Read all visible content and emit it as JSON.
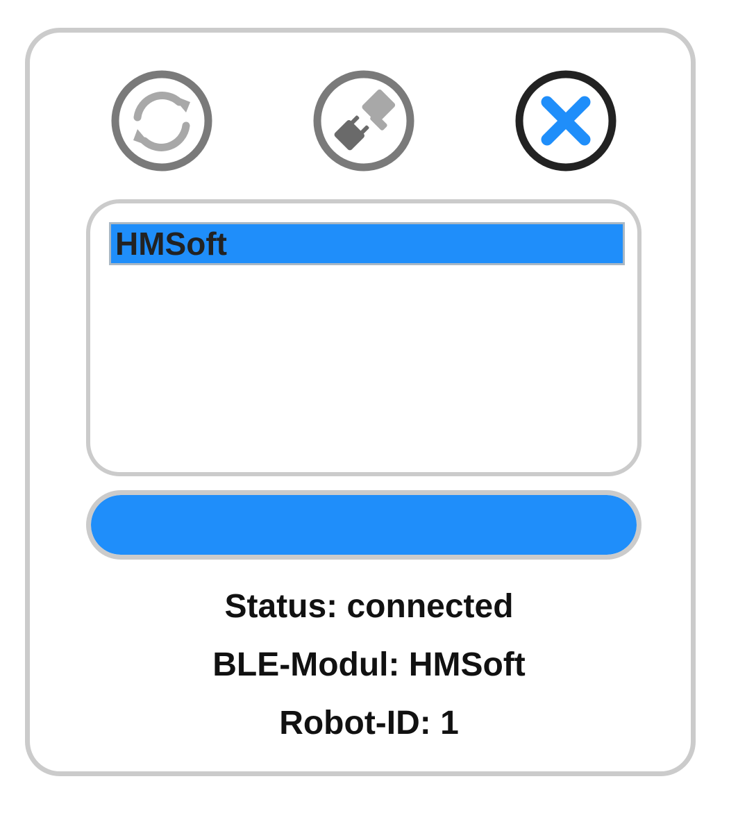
{
  "toolbar": {
    "refresh_icon": "refresh-icon",
    "connect_icon": "plug-icon",
    "close_icon": "close-icon"
  },
  "device_list": {
    "items": [
      {
        "label": "HMSoft",
        "selected": true
      }
    ]
  },
  "progress": {
    "fraction": 1.0
  },
  "status": {
    "line1": "Status: connected",
    "line2": "BLE-Modul: HMSoft",
    "line3": "Robot-ID: 1"
  },
  "colors": {
    "accent": "#1f8efa",
    "border": "#cbcbcb",
    "icon_gray": "#7a7a7a",
    "icon_light_gray": "#a8a8a8",
    "icon_dark": "#222222"
  }
}
